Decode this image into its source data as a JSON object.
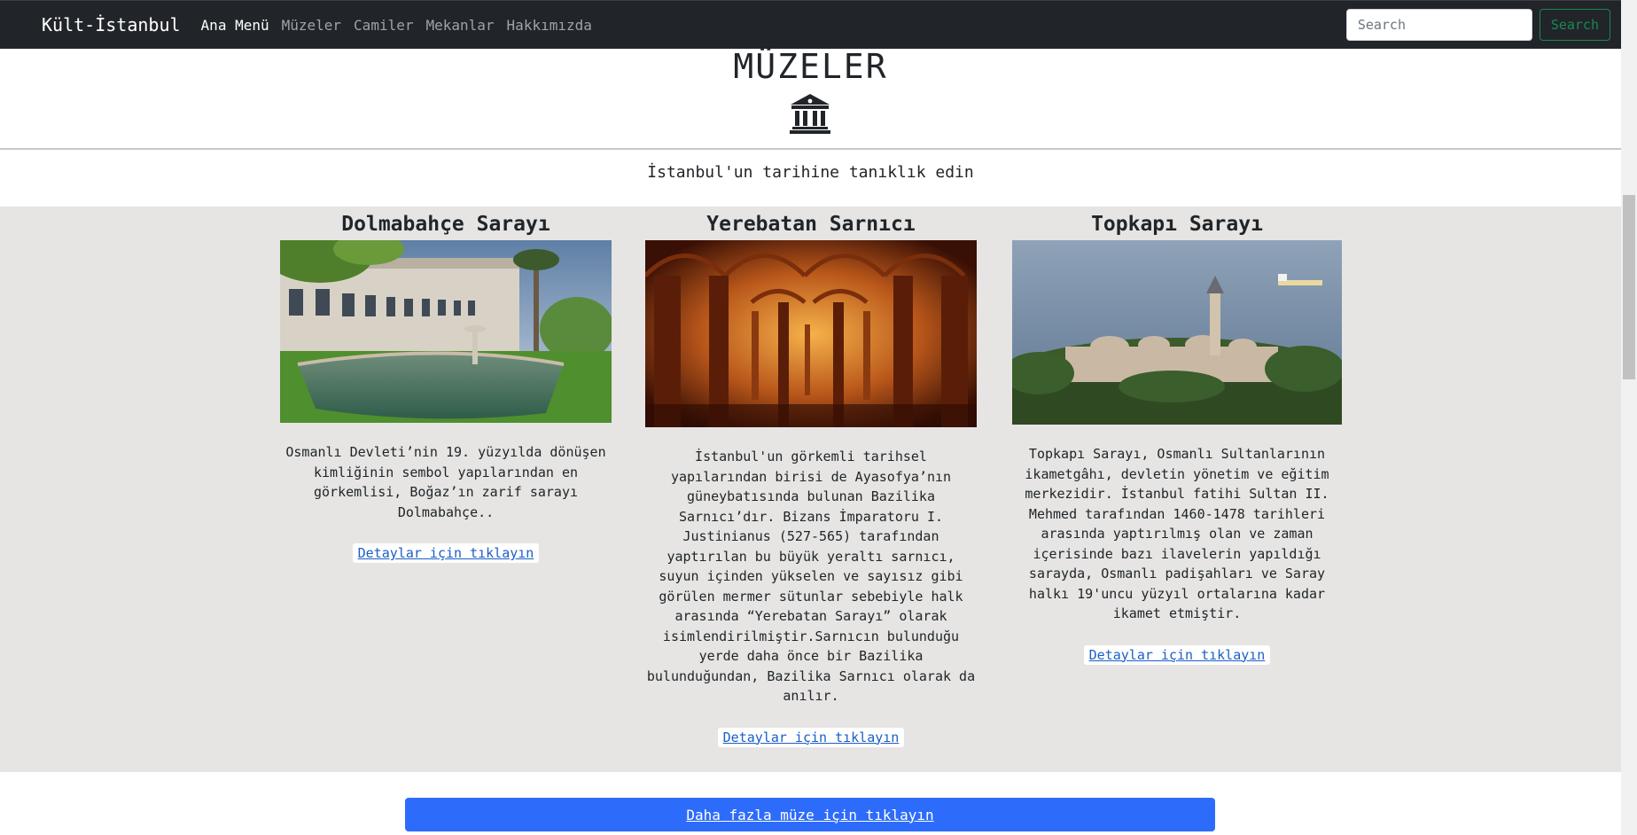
{
  "nav": {
    "brand": "Kült-İstanbul",
    "links": [
      "Ana Menü",
      "Müzeler",
      "Camiler",
      "Mekanlar",
      "Hakkımızda"
    ],
    "search_placeholder": "Search",
    "search_button": "Search"
  },
  "hero": {
    "title": "MÜZELER",
    "icon": "museum-icon",
    "tagline": "İstanbul'un tarihine tanıklık edin"
  },
  "cards": [
    {
      "title": "Dolmabahçe Sarayı",
      "description": "Osmanlı Devleti’nin 19. yüzyılda dönüşen kimliğinin sembol yapılarından en görkemlisi, Boğaz’ın zarif sarayı Dolmabahçe..",
      "link": "Detaylar için tıklayın"
    },
    {
      "title": "Yerebatan Sarnıcı",
      "description": "İstanbul'un görkemli tarihsel yapılarından birisi de Ayasofya’nın güneybatısında bulunan Bazilika Sarnıcı’dır. Bizans İmparatoru I. Justinianus (527-565) tarafından yaptırılan bu büyük yeraltı sarnıcı, suyun içinden yükselen ve sayısız gibi görülen mermer sütunlar sebebiyle halk arasında “Yerebatan Sarayı” olarak isimlendirilmiştir.Sarnıcın bulunduğu yerde daha önce bir Bazilika bulunduğundan, Bazilika Sarnıcı olarak da anılır.",
      "link": "Detaylar için tıklayın"
    },
    {
      "title": "Topkapı Sarayı",
      "description": "Topkapı Sarayı, Osmanlı Sultanlarının ikametgâhı, devletin yönetim ve eğitim merkezidir. İstanbul fatihi Sultan II. Mehmed tarafından 1460-1478 tarihleri arasında yaptırılmış olan ve zaman içerisinde bazı ilavelerin yapıldığı sarayda, Osmanlı padişahları ve Saray halkı 19'uncu yüzyıl ortalarına kadar ikamet etmiştir.",
      "link": "Detaylar için tıklayın"
    }
  ],
  "more_button": "Daha fazla müze için tıklayın",
  "colors": {
    "navbar": "#212529",
    "band": "#e6e5e3",
    "primary": "#2d6cfb",
    "success": "#198754",
    "link": "#1a5fc8"
  }
}
